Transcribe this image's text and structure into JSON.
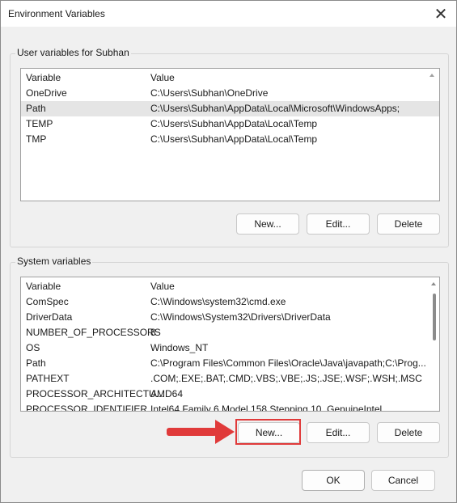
{
  "window": {
    "title": "Environment Variables"
  },
  "user_vars": {
    "group_label": "User variables for Subhan",
    "col_variable": "Variable",
    "col_value": "Value",
    "rows": [
      {
        "name": "OneDrive",
        "value": "C:\\Users\\Subhan\\OneDrive"
      },
      {
        "name": "Path",
        "value": "C:\\Users\\Subhan\\AppData\\Local\\Microsoft\\WindowsApps;"
      },
      {
        "name": "TEMP",
        "value": "C:\\Users\\Subhan\\AppData\\Local\\Temp"
      },
      {
        "name": "TMP",
        "value": "C:\\Users\\Subhan\\AppData\\Local\\Temp"
      }
    ],
    "selected_row": "Path",
    "new_label": "New...",
    "edit_label": "Edit...",
    "delete_label": "Delete"
  },
  "system_vars": {
    "group_label": "System variables",
    "col_variable": "Variable",
    "col_value": "Value",
    "rows": [
      {
        "name": "ComSpec",
        "value": "C:\\Windows\\system32\\cmd.exe"
      },
      {
        "name": "DriverData",
        "value": "C:\\Windows\\System32\\Drivers\\DriverData"
      },
      {
        "name": "NUMBER_OF_PROCESSORS",
        "value": "8"
      },
      {
        "name": "OS",
        "value": "Windows_NT"
      },
      {
        "name": "Path",
        "value": "C:\\Program Files\\Common Files\\Oracle\\Java\\javapath;C:\\Prog..."
      },
      {
        "name": "PATHEXT",
        "value": ".COM;.EXE;.BAT;.CMD;.VBS;.VBE;.JS;.JSE;.WSF;.WSH;.MSC"
      },
      {
        "name": "PROCESSOR_ARCHITECTU...",
        "value": "AMD64"
      },
      {
        "name": "PROCESSOR_IDENTIFIER",
        "value": "Intel64 Family 6 Model 158 Stepping 10, GenuineIntel"
      }
    ],
    "new_label": "New...",
    "edit_label": "Edit...",
    "delete_label": "Delete"
  },
  "footer": {
    "ok_label": "OK",
    "cancel_label": "Cancel"
  },
  "colors": {
    "annotation": "#e03a3a",
    "selection": "#e5e5e5"
  }
}
